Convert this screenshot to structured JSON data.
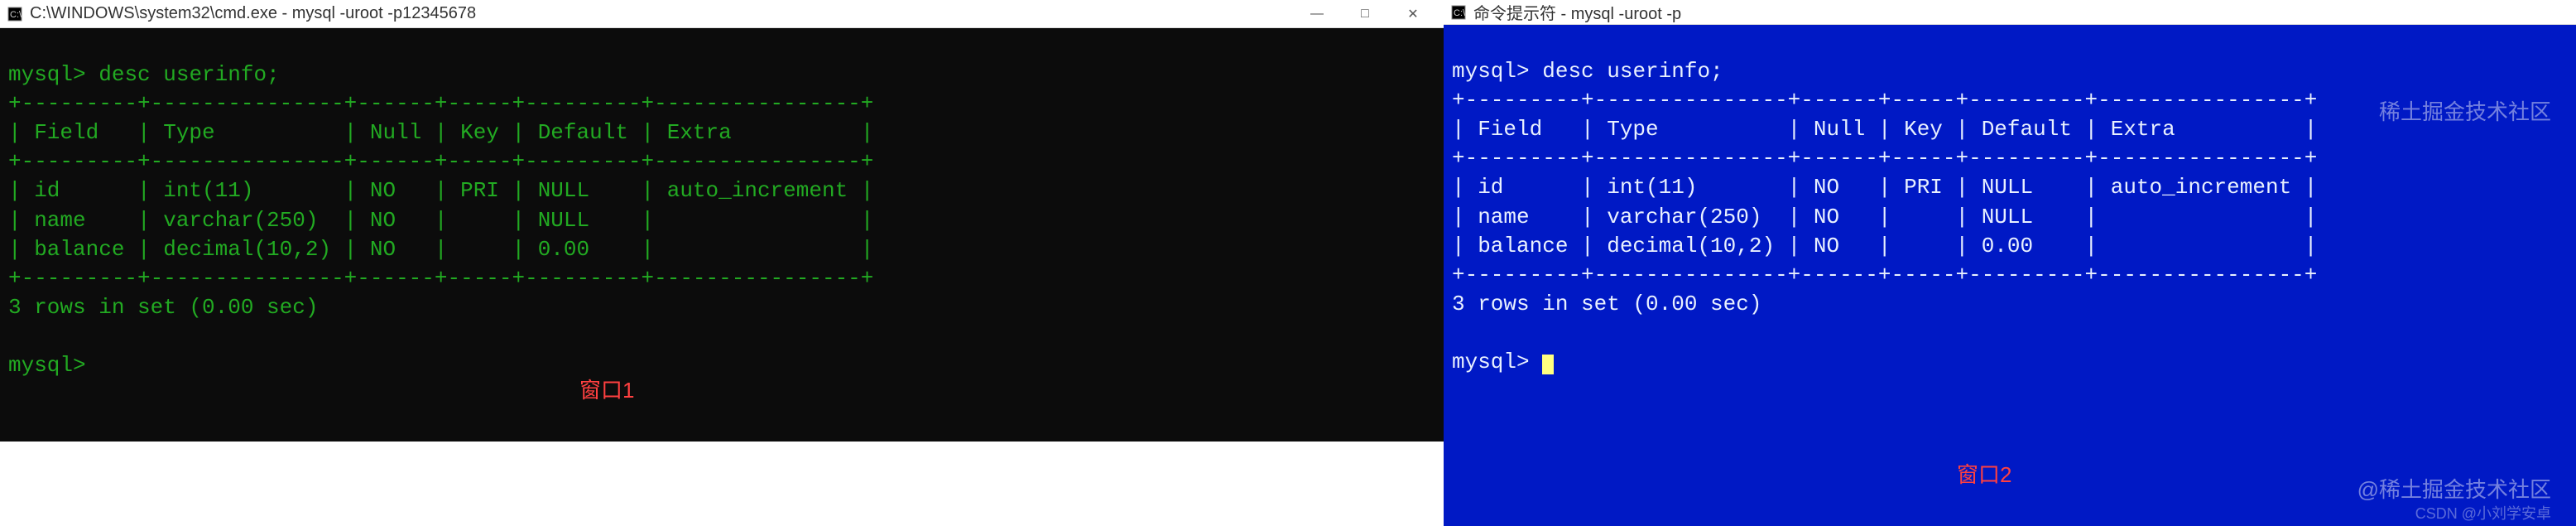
{
  "windows": {
    "left": {
      "titlebar_text": "C:\\WINDOWS\\system32\\cmd.exe - mysql  -uroot -p12345678",
      "label": "窗口1",
      "bg": "black",
      "text_color": "green"
    },
    "right": {
      "titlebar_text": "命令提示符 - mysql  -uroot -p",
      "label": "窗口2",
      "bg": "blue",
      "text_color": "white"
    }
  },
  "mysql": {
    "prompt": "mysql>",
    "command": "desc userinfo;",
    "table_headers": [
      "Field",
      "Type",
      "Null",
      "Key",
      "Default",
      "Extra"
    ],
    "rows": [
      {
        "Field": "id",
        "Type": "int(11)",
        "Null": "NO",
        "Key": "PRI",
        "Default": "NULL",
        "Extra": "auto_increment"
      },
      {
        "Field": "name",
        "Type": "varchar(250)",
        "Null": "NO",
        "Key": "",
        "Default": "NULL",
        "Extra": ""
      },
      {
        "Field": "balance",
        "Type": "decimal(10,2)",
        "Null": "NO",
        "Key": "",
        "Default": "0.00",
        "Extra": ""
      }
    ],
    "status": "3 rows in set (0.00 sec)",
    "border_top": "+---------+---------------+------+-----+---------+----------------+",
    "header_row": "| Field   | Type          | Null | Key | Default | Extra          |",
    "row_lines": [
      "| id      | int(11)       | NO   | PRI | NULL    | auto_increment |",
      "| name    | varchar(250)  | NO   |     | NULL    |                |",
      "| balance | decimal(10,2) | NO   |     | 0.00    |                |"
    ]
  },
  "watermark": {
    "top": "稀土掘金技术社区",
    "bottom": "@稀土掘金技术社区",
    "csdn": "CSDN @小刘学安卓"
  },
  "win_controls": {
    "minimize": "—",
    "maximize": "□",
    "close": "✕"
  },
  "chart_data": {
    "type": "table",
    "title": "desc userinfo",
    "columns": [
      "Field",
      "Type",
      "Null",
      "Key",
      "Default",
      "Extra"
    ],
    "rows": [
      [
        "id",
        "int(11)",
        "NO",
        "PRI",
        "NULL",
        "auto_increment"
      ],
      [
        "name",
        "varchar(250)",
        "NO",
        "",
        "NULL",
        ""
      ],
      [
        "balance",
        "decimal(10,2)",
        "NO",
        "",
        "0.00",
        ""
      ]
    ]
  }
}
